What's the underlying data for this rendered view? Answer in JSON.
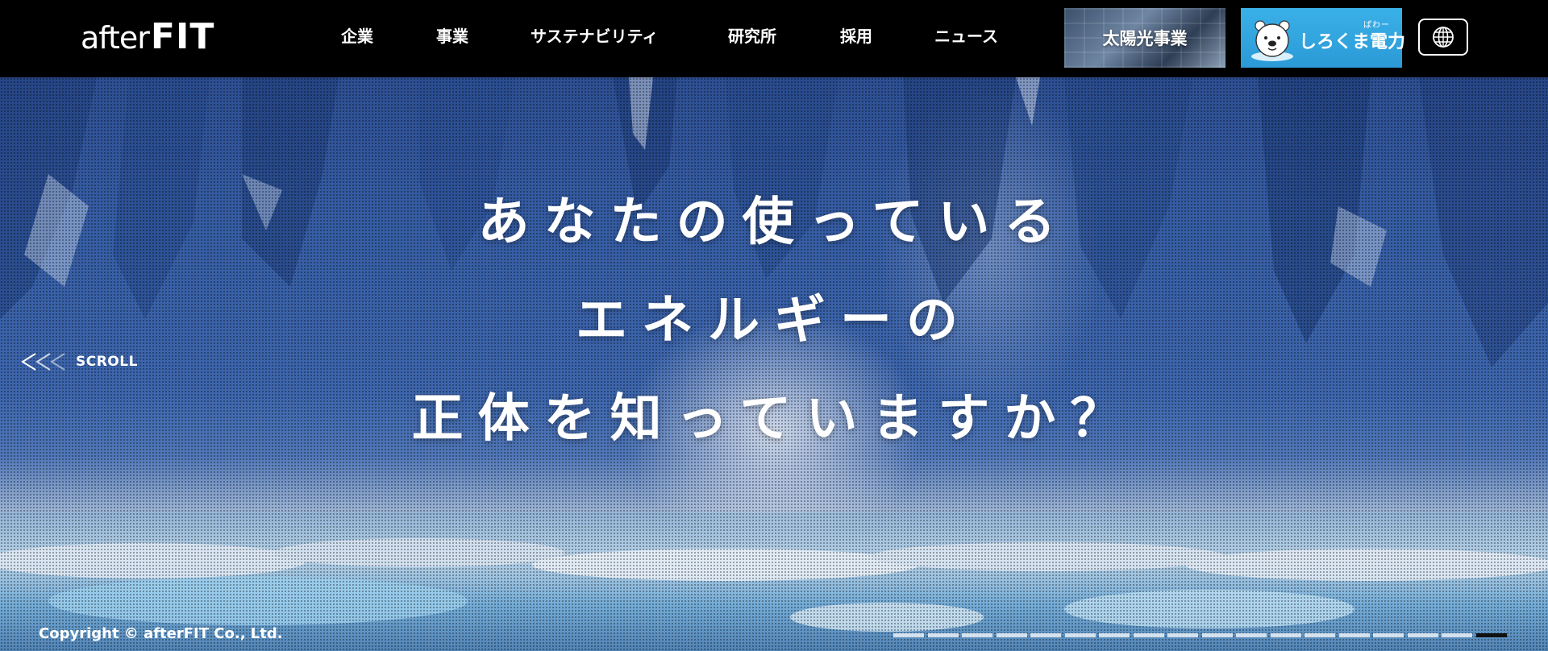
{
  "header": {
    "logo": {
      "part_a": "after",
      "part_b": "FIT"
    },
    "nav": [
      {
        "label": "企業"
      },
      {
        "label": "事業"
      },
      {
        "label": "サステナビリティ"
      },
      {
        "label": "研究所"
      },
      {
        "label": "採用"
      },
      {
        "label": "ニュース"
      }
    ],
    "solar_banner": {
      "label": "太陽光事業"
    },
    "shirokuma_banner": {
      "label": "しろくま電力",
      "ruby": "ぱわー"
    },
    "language_button": {
      "icon": "globe-icon"
    }
  },
  "hero": {
    "headline": [
      "あなたの使っている",
      "エネルギーの",
      "正体を知っていますか？"
    ],
    "scroll_label": "SCROLL",
    "copyright": "Copyright © afterFIT Co., Ltd.",
    "slides": {
      "total": 18,
      "active_index": 17
    }
  },
  "colors": {
    "header_bg": "#000000",
    "shirokuma_blue": "#2b9ad6",
    "text": "#ffffff"
  }
}
